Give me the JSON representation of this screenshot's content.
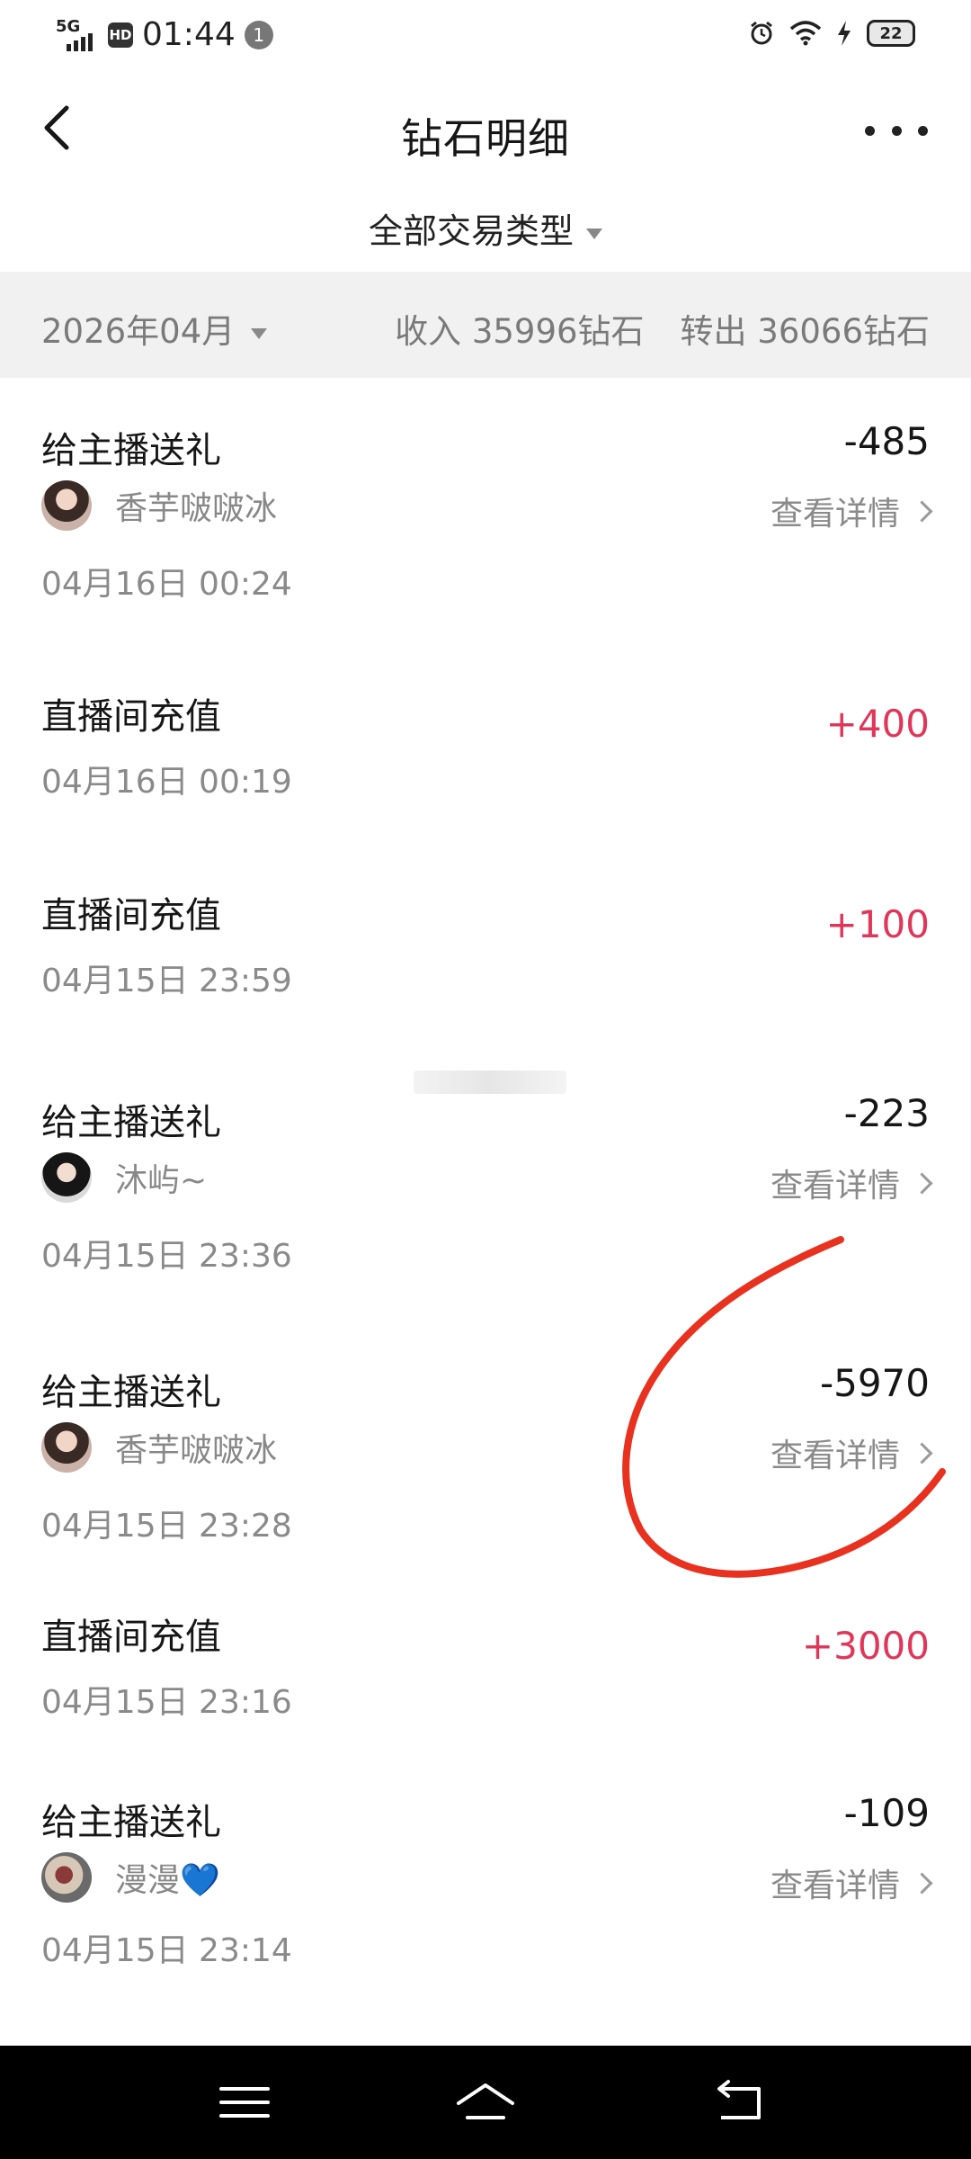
{
  "status_bar": {
    "network": "5G",
    "hd_badge": "HD",
    "time": "01:44",
    "notification_count": "1",
    "battery": "22"
  },
  "header": {
    "title": "钻石明细"
  },
  "filter": {
    "label": "全部交易类型"
  },
  "summary": {
    "month": "2026年04月",
    "income": "收入 35996钻石",
    "outgoing": "转出 36066钻石"
  },
  "transactions": [
    {
      "title": "给主播送礼",
      "amount": "-485",
      "user": "香芋啵啵冰",
      "detail": "查看详情",
      "time": "04月16日 00:24"
    },
    {
      "title": "直播间充值",
      "amount": "+400",
      "time": "04月16日 00:19"
    },
    {
      "title": "直播间充值",
      "amount": "+100",
      "time": "04月15日 23:59"
    },
    {
      "title": "给主播送礼",
      "amount": "-223",
      "user": "沐屿~",
      "detail": "查看详情",
      "time": "04月15日 23:36"
    },
    {
      "title": "给主播送礼",
      "amount": "-5970",
      "user": "香芋啵啵冰",
      "detail": "查看详情",
      "time": "04月15日 23:28"
    },
    {
      "title": "直播间充值",
      "amount": "+3000",
      "time": "04月15日 23:16"
    },
    {
      "title": "给主播送礼",
      "amount": "-109",
      "user": "漫漫💙",
      "detail": "查看详情",
      "time": "04月15日 23:14"
    }
  ],
  "colors": {
    "income_amount": "#e0365a",
    "annotation": "#e8311f",
    "summary_bg": "#f1f1f1"
  }
}
